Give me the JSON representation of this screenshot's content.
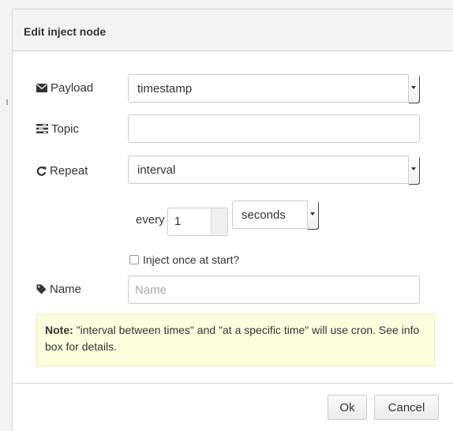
{
  "dialog": {
    "title": "Edit inject node"
  },
  "payload": {
    "label": "Payload",
    "icon": "envelope-icon",
    "selected": "timestamp"
  },
  "topic": {
    "label": "Topic",
    "icon": "tasks-icon",
    "value": ""
  },
  "repeat": {
    "label": "Repeat",
    "icon": "repeat-icon",
    "selected": "interval",
    "every_label": "every",
    "every_value": "1",
    "unit_selected": "seconds"
  },
  "inject_once": {
    "label": "Inject once at start?",
    "checked": false
  },
  "name": {
    "label": "Name",
    "icon": "tag-icon",
    "value": "",
    "placeholder": "Name"
  },
  "note": {
    "bold": "Note:",
    "text": " \"interval between times\" and \"at a specific time\" will use cron. See info box for details."
  },
  "buttons": {
    "ok": "Ok",
    "cancel": "Cancel"
  },
  "colors": {
    "note_background": "#ffffe0",
    "titlebar_background": "#f3f3f3"
  }
}
